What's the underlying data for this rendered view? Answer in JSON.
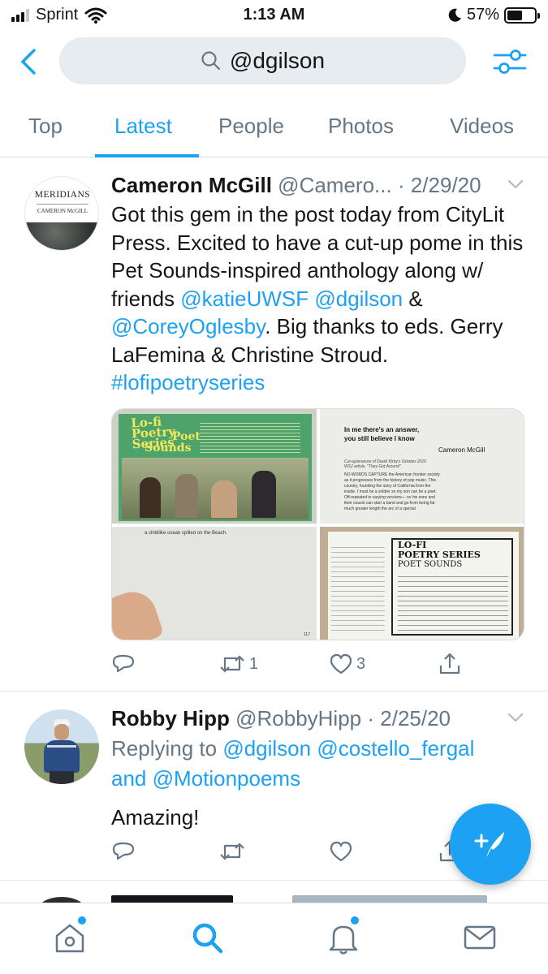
{
  "status_bar": {
    "carrier": "Sprint",
    "time": "1:13 AM",
    "battery": "57%",
    "battery_level": 0.57
  },
  "search": {
    "query": "@dgilson"
  },
  "tabs": [
    {
      "label": "Top"
    },
    {
      "label": "Latest"
    },
    {
      "label": "People"
    },
    {
      "label": "Photos"
    },
    {
      "label": "Videos"
    }
  ],
  "tweets": [
    {
      "name": "Cameron McGill",
      "handle": "@Camero...",
      "date": "· 2/29/20",
      "avatar_text": {
        "title": "MERIDIANS",
        "sub": "CAMERON McGILL"
      },
      "text": {
        "p1": "Got this gem in the post today from CityLit Press. Excited to have a cut-up pome in this Pet Sounds-inspired anthology along w/ friends ",
        "m1": "@katieUWSF",
        "m2": "@dgilson",
        "p2": " & ",
        "m3": "@CoreyOglesby",
        "p3": ". Big thanks to eds. Gerry LaFemina & Christine Stroud. ",
        "tag": "#lofipoetryseries"
      },
      "media": {
        "cover": {
          "title_line1": "Lo-fi",
          "title_line2": "Poetry",
          "title_line3": "Series",
          "title_poet": "Poet",
          "title_sounds": "Sounds"
        },
        "page": {
          "heading_line1": "In me there's an answer,",
          "heading_line2": "you still believe I know",
          "author": "Cameron McGill",
          "credit": "Cut-up/erasure of David Kirby's October 2016 WSJ article, \"They Got Around\"",
          "body": "NO WORDS CAPTURE the American frontier society as it progresses from the history of pop music. This country, founding the story of California from the inside. I must be a soldier so my son can be a poet. Off-repeated in varying versions— so his sons and their cousin can start a band and go from being fat much greater length the arc of a special"
        },
        "blank_page": {
          "line": "a childlike ocean spilled on the Beach.",
          "page_no": "117"
        },
        "contents": {
          "title1": "LO-FI",
          "title2": "POETRY SERIES",
          "title3": "POET SOUNDS"
        }
      },
      "actions": {
        "retweets": "1",
        "likes": "3"
      }
    },
    {
      "name": "Robby Hipp",
      "handle": "@RobbyHipp",
      "date": "· 2/25/20",
      "reply_prefix": "Replying to ",
      "reply_to_1": "@dgilson",
      "reply_to_2": "@costello_fergal",
      "reply_and": "and ",
      "reply_to_3": "@Motionpoems",
      "text": "Amazing!"
    }
  ],
  "colors": {
    "accent": "#1da1f2",
    "text": "#14171a",
    "secondary": "#657786"
  }
}
